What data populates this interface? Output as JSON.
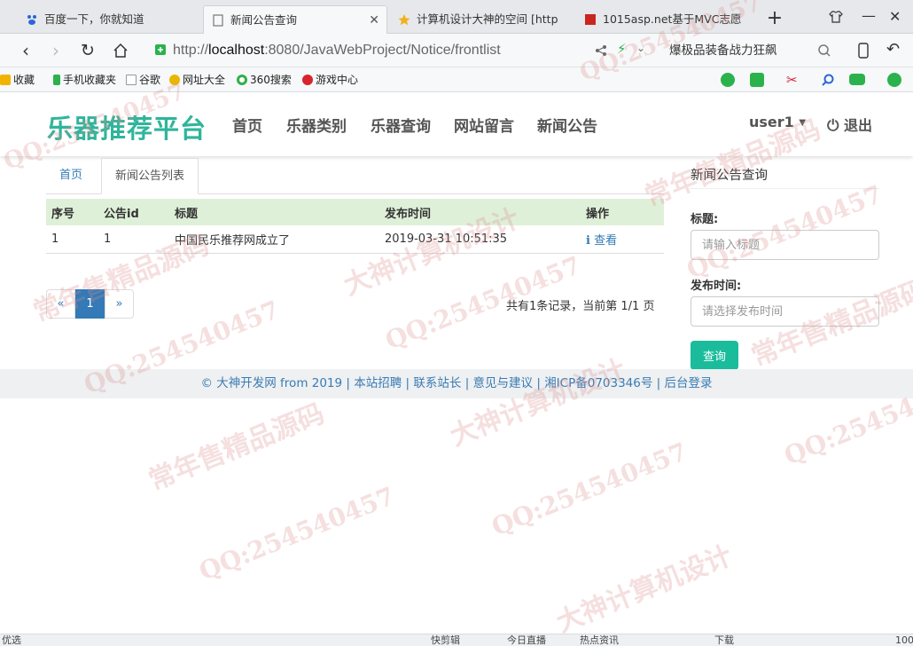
{
  "browser": {
    "tabs": [
      {
        "title": "百度一下，你就知道"
      },
      {
        "title": "新闻公告查询"
      },
      {
        "title": "计算机设计大神的空间 [http"
      },
      {
        "title": "1015asp.net基于MVC志愿"
      }
    ],
    "url_prefix": "http://",
    "url_host": "localhost",
    "url_rest": ":8080/JavaWebProject/Notice/frontlist",
    "search_suggestion": "爆极品装备战力狂飙",
    "bookmarks": [
      "收藏",
      "手机收藏夹",
      "谷歌",
      "网址大全",
      "360搜索",
      "游戏中心"
    ]
  },
  "header": {
    "brand": "乐器推荐平台",
    "nav": [
      "首页",
      "乐器类别",
      "乐器查询",
      "网站留言",
      "新闻公告"
    ],
    "user": "user1",
    "logout": "退出"
  },
  "main": {
    "tabs": {
      "home": "首页",
      "current": "新闻公告列表"
    },
    "table": {
      "columns": [
        "序号",
        "公告id",
        "标题",
        "发布时间",
        "操作"
      ],
      "rows": [
        {
          "index": "1",
          "id": "1",
          "title": "中国民乐推荐网成立了",
          "time": "2019-03-31 10:51:35",
          "action": "查看"
        }
      ]
    },
    "pager": {
      "prev": "«",
      "current": "1",
      "next": "»",
      "info": "共有1条记录，当前第 1/1 页"
    }
  },
  "sidebar": {
    "title": "新闻公告查询",
    "title_label": "标题:",
    "title_placeholder": "请输入标题",
    "date_label": "发布时间:",
    "date_placeholder": "请选择发布时间",
    "query_button": "查询"
  },
  "footer": {
    "links": [
      "© 大神开发网 from 2019",
      "本站招聘",
      "联系站长",
      "意见与建议",
      "湘ICP备0703346号",
      "后台登录"
    ]
  },
  "watermarks": [
    "QQ:254540457",
    "常年售精品源码",
    "大神计算机设计"
  ],
  "statusbar": {
    "items": [
      "优选",
      "快剪辑",
      "今日直播",
      "热点资讯",
      "下载",
      "100"
    ]
  }
}
